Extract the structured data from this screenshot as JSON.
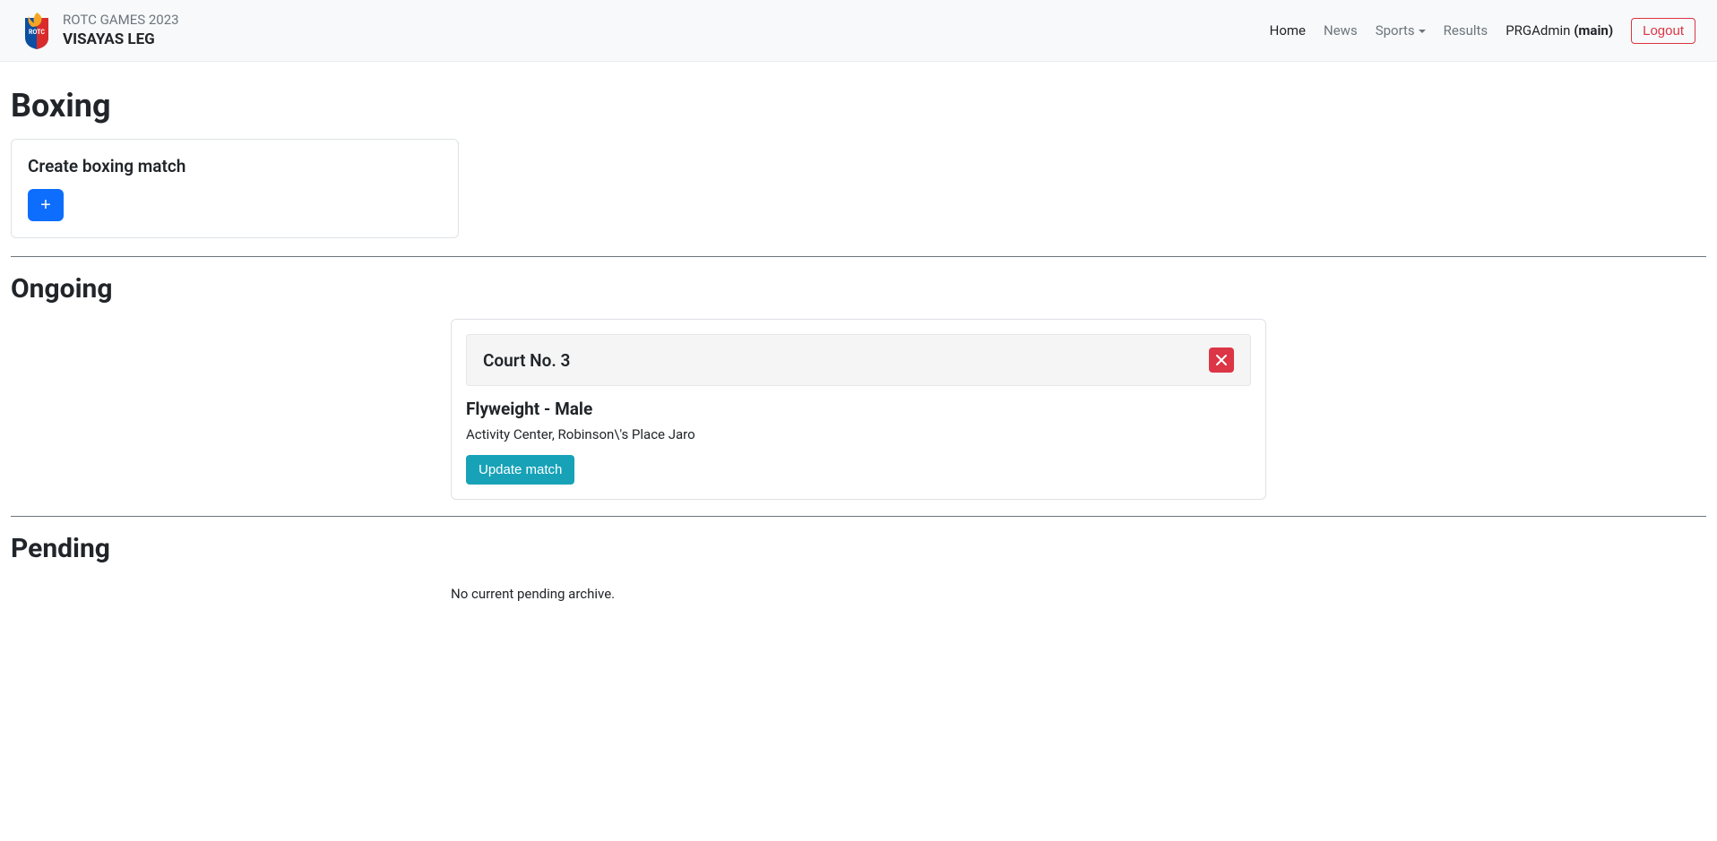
{
  "header": {
    "brand_line1": "ROTC GAMES 2023",
    "brand_line2": "VISAYAS LEG",
    "nav": {
      "home": "Home",
      "news": "News",
      "sports": "Sports",
      "results": "Results"
    },
    "user_name": "PRGAdmin",
    "user_role": "(main)",
    "logout_label": "Logout"
  },
  "page": {
    "title": "Boxing",
    "create_card": {
      "title": "Create boxing match",
      "button_label": "+"
    },
    "ongoing": {
      "heading": "Ongoing",
      "match": {
        "court": "Court No. 3",
        "category": "Flyweight - Male",
        "location": "Activity Center, Robinson\\'s Place Jaro",
        "update_label": "Update match"
      }
    },
    "pending": {
      "heading": "Pending",
      "empty_message": "No current pending archive."
    }
  }
}
